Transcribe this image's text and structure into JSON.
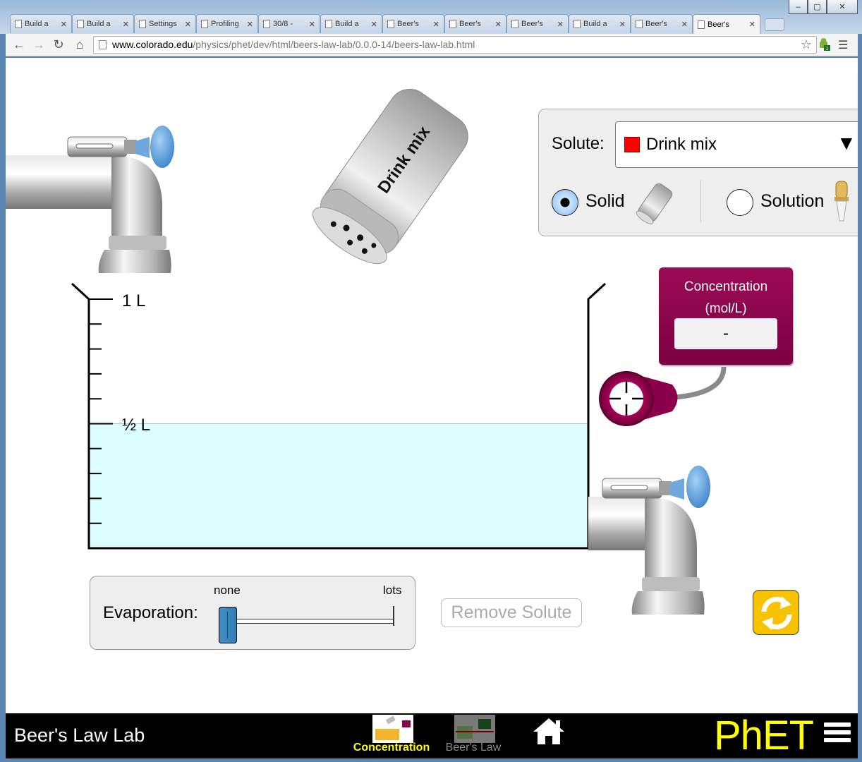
{
  "browser": {
    "tabs": [
      {
        "label": "Build a",
        "icon": "page-icon"
      },
      {
        "label": "Build a",
        "icon": "page-icon"
      },
      {
        "label": "Settings",
        "icon": "wrench-icon"
      },
      {
        "label": "Profiling",
        "icon": "profiler-icon"
      },
      {
        "label": "30/8 -",
        "icon": "google-icon"
      },
      {
        "label": "Build a",
        "icon": "page-icon"
      },
      {
        "label": "Beer's",
        "icon": "page-icon"
      },
      {
        "label": "Beer's",
        "icon": "page-icon"
      },
      {
        "label": "Beer's",
        "icon": "page-icon"
      },
      {
        "label": "Build a",
        "icon": "page-icon"
      },
      {
        "label": "Beer's",
        "icon": "page-icon"
      },
      {
        "label": "Beer's",
        "icon": "colorado-icon",
        "active": true
      }
    ],
    "url_host": "www.colorado.edu",
    "url_path": "/physics/phet/dev/html/beers-law-lab/0.0.0-14/beers-law-lab.html",
    "window_controls": {
      "minimize": "‒",
      "maximize": "▢",
      "close": "✕"
    }
  },
  "sim": {
    "shaker_label": "Drink mix",
    "beaker": {
      "label_1L": "1 L",
      "label_half": "½ L",
      "solution_volume_L": 0.5,
      "solution_color": "#dcfeff"
    },
    "solute_panel": {
      "solute_label": "Solute:",
      "selected_solute": "Drink mix",
      "solute_color": "#ff0000",
      "solid_label": "Solid",
      "solution_label": "Solution",
      "selected_form": "Solid"
    },
    "concentration_meter": {
      "title_line1": "Concentration",
      "title_line2": "(mol/L)",
      "value": "-",
      "body_color": "#8a004b"
    },
    "evaporation": {
      "label": "Evaporation:",
      "min_label": "none",
      "max_label": "lots",
      "value": 0
    },
    "remove_solute_label": "Remove Solute",
    "reset_color": "#f7c200"
  },
  "navbar": {
    "title": "Beer's Law Lab",
    "screens": [
      {
        "label": "Concentration",
        "selected": true,
        "color": "#ffff00"
      },
      {
        "label": "Beer's Law",
        "selected": false,
        "color": "#888888"
      }
    ],
    "logo": "PhET",
    "logo_color": "#ffff00"
  }
}
